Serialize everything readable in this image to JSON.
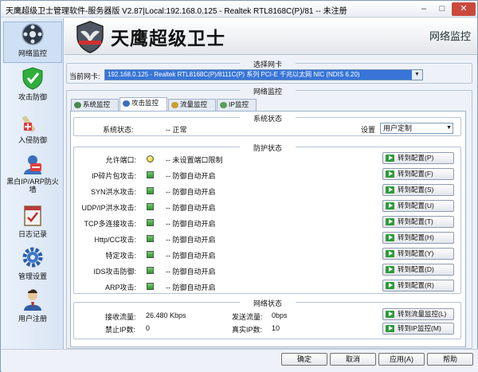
{
  "window": {
    "title": "天鹰超级卫士管理软件-服务器版 V2.87|Local:192.168.0.125 - Realtek RTL8168C(P)/81 -- 未注册"
  },
  "banner": {
    "title": "天鹰超级卫士",
    "tag": "网络监控"
  },
  "sidebar": {
    "items": [
      {
        "label": "网络监控",
        "icon": "network-monitor-icon"
      },
      {
        "label": "攻击防御",
        "icon": "shield-check-icon"
      },
      {
        "label": "入侵防御",
        "icon": "intrusion-icon"
      },
      {
        "label": "黑白IP/ARP防火墙",
        "icon": "firewall-icon"
      },
      {
        "label": "日志记录",
        "icon": "log-icon"
      },
      {
        "label": "管理设置",
        "icon": "gear-icon"
      },
      {
        "label": "用户注册",
        "icon": "user-icon"
      }
    ]
  },
  "nic": {
    "section_title": "选择网卡",
    "label": "当前网卡:",
    "value": "192.168.0.125 - Realtek RTL8168C(P)/8111C(P) 系列 PCI-E 千兆以太网 NIC (NDIS 6.20)"
  },
  "monitor": {
    "section_title": "网络监控"
  },
  "tabs": [
    "系统监控",
    "攻击监控",
    "流量监控",
    "IP监控"
  ],
  "system": {
    "section_title": "系统状态",
    "status_label": "系统状态:",
    "status_value": "-- 正常",
    "setting_label": "设置",
    "setting_value": "用户定制"
  },
  "protection": {
    "section_title": "防护状态",
    "rows": [
      {
        "name": "允许端口:",
        "status": "-- 未设置端口限制",
        "color": "#e0c000",
        "button": "转到配置(P)"
      },
      {
        "name": "IP碎片包攻击:",
        "status": "-- 防御自动开启",
        "color": "#2a9a2a",
        "button": "转到配置(F)"
      },
      {
        "name": "SYN洪水攻击:",
        "status": "-- 防御自动开启",
        "color": "#2a9a2a",
        "button": "转到配置(S)"
      },
      {
        "name": "UDP/IP洪水攻击:",
        "status": "-- 防御自动开启",
        "color": "#2a9a2a",
        "button": "转到配置(U)"
      },
      {
        "name": "TCP多连接攻击:",
        "status": "-- 防御自动开启",
        "color": "#2a9a2a",
        "button": "转到配置(T)"
      },
      {
        "name": "Http/CC攻击:",
        "status": "-- 防御自动开启",
        "color": "#2a9a2a",
        "button": "转到配置(H)"
      },
      {
        "name": "特定攻击:",
        "status": "-- 防御自动开启",
        "color": "#2a9a2a",
        "button": "转到配置(Y)"
      },
      {
        "name": "IDS攻击防御:",
        "status": "-- 防御自动开启",
        "color": "#2a9a2a",
        "button": "转到配置(D)"
      },
      {
        "name": "ARP攻击:",
        "status": "-- 防御自动开启",
        "color": "#2a9a2a",
        "button": "转到配置(R)"
      }
    ]
  },
  "network": {
    "section_title": "网络状态",
    "recv_label": "接收流量:",
    "recv_value": "26.480 Kbps",
    "send_label": "发送流量:",
    "send_value": "0bps",
    "ban_label": "禁止IP数:",
    "ban_value": "0",
    "real_label": "真实IP数:",
    "real_value": "10",
    "flow_button": "转到流量监控(L)",
    "ip_button": "转到IP监控(M)"
  },
  "buttons": {
    "ok": "确定",
    "cancel": "取消",
    "apply": "应用(A)",
    "help": "帮助"
  }
}
